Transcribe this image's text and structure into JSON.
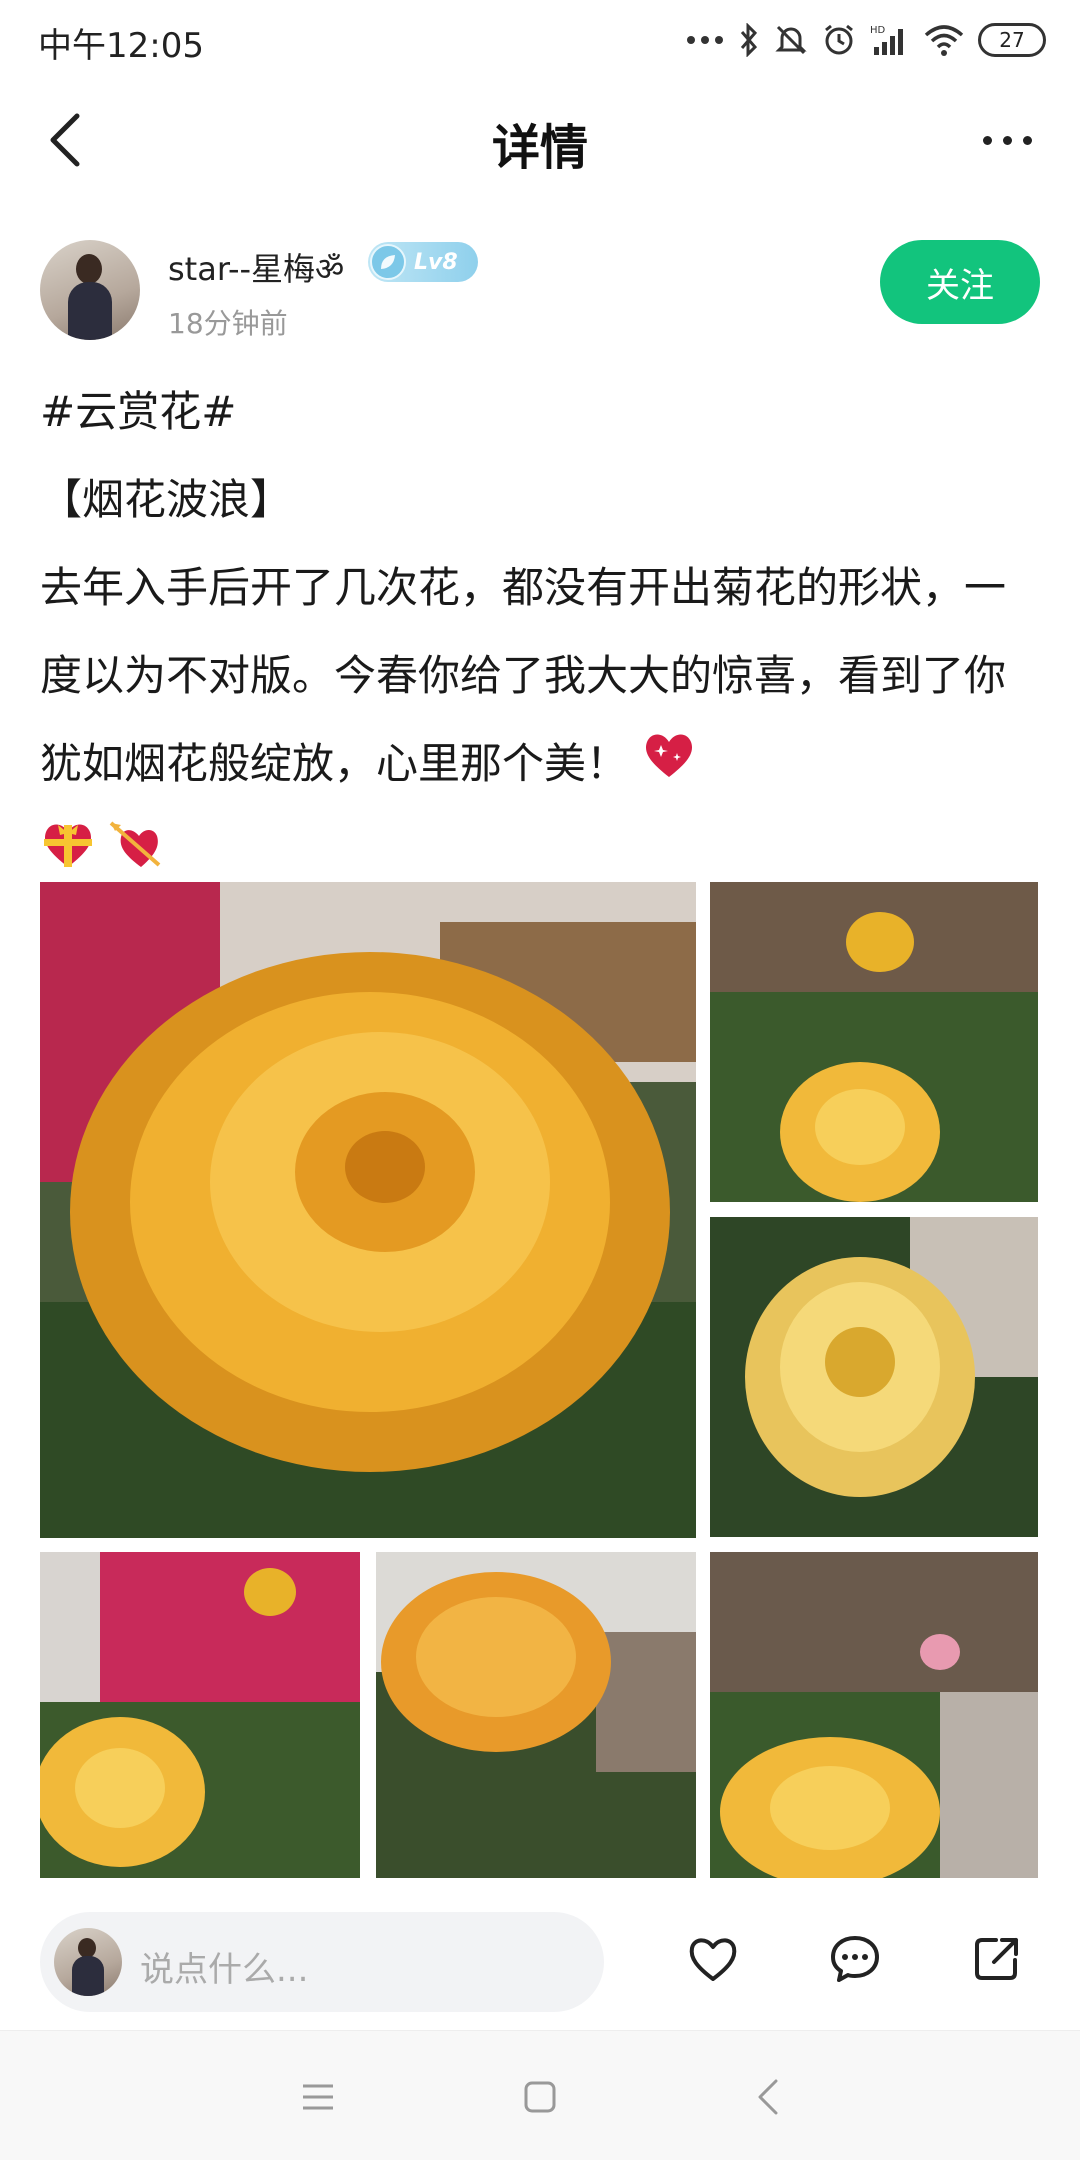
{
  "status_bar": {
    "time": "中午12:05",
    "battery": "27",
    "icons": [
      "more-dots-icon",
      "bluetooth-icon",
      "mute-icon",
      "alarm-icon",
      "hd-signal-icon",
      "wifi-icon",
      "battery-icon"
    ]
  },
  "nav": {
    "title": "详情",
    "back_icon": "back-arrow-icon",
    "more_icon": "more-icon"
  },
  "author": {
    "name": "star--星梅ॐ",
    "level": "Lv8",
    "time": "18分钟前",
    "follow_label": "关注"
  },
  "post": {
    "hashtag": "#云赏花#",
    "title": "【烟花波浪】",
    "body": "去年入手后开了几次花，都没有开出菊花的形状，一度以为不对版。今春你给了我大大的惊喜，看到了你犹如烟花般绽放，心里那个美！",
    "emojis": [
      "sparkling-heart-icon",
      "gift-heart-icon",
      "heart-arrow-icon"
    ]
  },
  "photos": [
    {
      "name": "photo-main",
      "subject": "orange-yellow dahlia-like rose close-up"
    },
    {
      "name": "photo-2",
      "subject": "rose bud and yellow bloom"
    },
    {
      "name": "photo-3",
      "subject": "pale yellow ruffled rose"
    },
    {
      "name": "photo-4",
      "subject": "yellow rose with pink bougainvillea"
    },
    {
      "name": "photo-5",
      "subject": "orange ruffled rose by railing"
    },
    {
      "name": "photo-6",
      "subject": "yellow rose in garden"
    }
  ],
  "bottom_bar": {
    "comment_placeholder": "说点什么...",
    "like_icon": "heart-icon",
    "comment_icon": "comment-icon",
    "share_icon": "share-icon"
  },
  "colors": {
    "accent": "#12c47d",
    "text": "#1a1a1a",
    "muted": "#999999",
    "level_badge": "#8fd0ec"
  }
}
